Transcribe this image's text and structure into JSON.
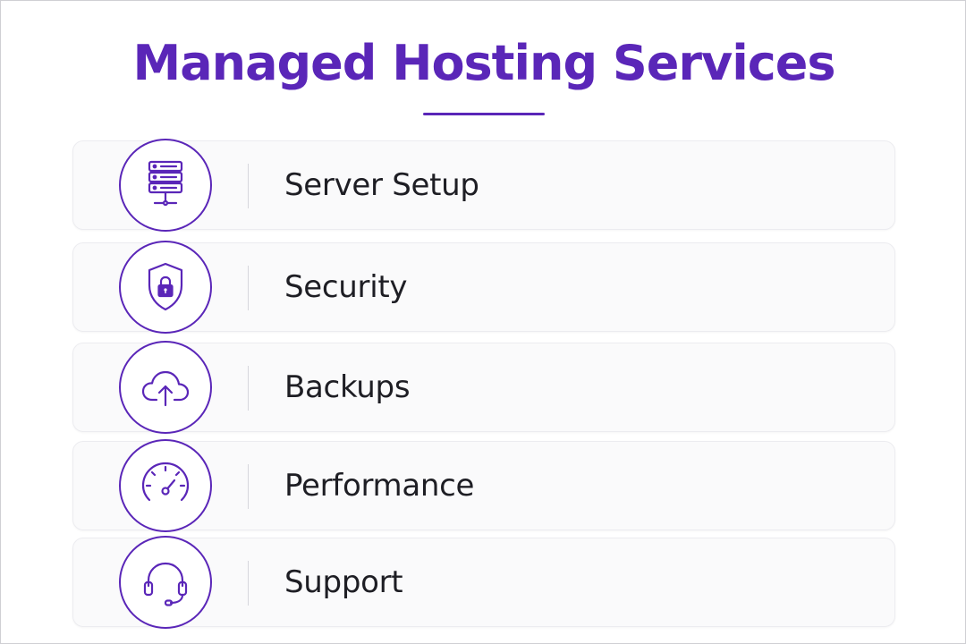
{
  "page": {
    "title": "Managed Hosting Services",
    "accent_color": "#5a26b8"
  },
  "services": [
    {
      "label": "Server Setup",
      "icon": "server-icon"
    },
    {
      "label": "Security",
      "icon": "shield-lock-icon"
    },
    {
      "label": "Backups",
      "icon": "cloud-upload-icon"
    },
    {
      "label": "Performance",
      "icon": "speedometer-icon"
    },
    {
      "label": "Support",
      "icon": "headset-icon"
    }
  ]
}
